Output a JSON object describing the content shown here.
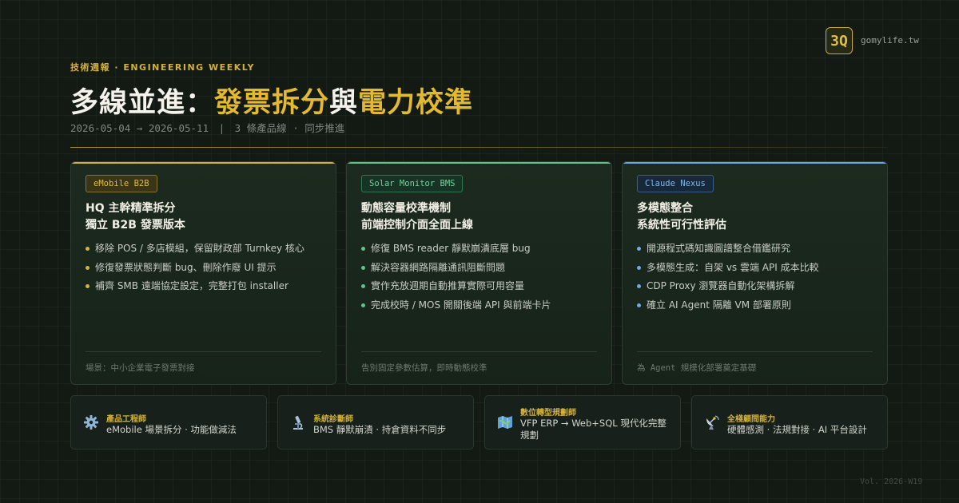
{
  "brand": {
    "logo_text": "3Q",
    "domain": "gomylife.tw"
  },
  "header": {
    "kicker": "技術週報 · ENGINEERING WEEKLY",
    "title_part1": "多線並進：",
    "title_part2": "發票拆分",
    "title_part3": "與",
    "title_part4": "電力校準",
    "meta": "2026-05-04 → 2026-05-11　|　3 條產品線 · 同步推進"
  },
  "colors": {
    "gold": "#d6b23a",
    "green": "#5ec48a",
    "blue": "#6ea8e6"
  },
  "cards": [
    {
      "tag": "eMobile B2B",
      "title_lines": [
        "HQ 主幹精準拆分",
        "獨立 B2B 發票版本"
      ],
      "bullets": [
        "移除 POS / 多店模組，保留財政部 Turnkey 核心",
        "修復發票狀態判斷 bug、刪除作廢 UI 提示",
        "補齊 SMB 遠端協定設定，完整打包 installer"
      ],
      "footer": "場景：中小企業電子發票對接"
    },
    {
      "tag": "Solar Monitor BMS",
      "title_lines": [
        "動態容量校準機制",
        "前端控制介面全面上線"
      ],
      "bullets": [
        "修復 BMS reader 靜默崩潰底層 bug",
        "解決容器網路隔離通訊阻斷問題",
        "實作充放週期自動推算實際可用容量",
        "完成校時 / MOS 開關後端 API 與前端卡片"
      ],
      "footer": "告別固定參數估算，即時動態校準"
    },
    {
      "tag": "Claude Nexus",
      "title_lines": [
        "多模態整合",
        "系統性可行性評估"
      ],
      "bullets": [
        "開源程式碼知識圖譜整合借鑑研究",
        "多模態生成：自架 vs 雲端 API 成本比較",
        "CDP Proxy 瀏覽器自動化架構拆解",
        "確立 AI Agent 隔離 VM 部署原則"
      ],
      "footer": "為 Agent 規模化部署奠定基礎"
    }
  ],
  "roles": [
    {
      "icon": "gear-icon",
      "title": "產品工程師",
      "desc": "eMobile 場景拆分 · 功能做減法"
    },
    {
      "icon": "microscope-icon",
      "title": "系統診斷師",
      "desc": "BMS 靜默崩潰 · 持倉資料不同步"
    },
    {
      "icon": "map-icon",
      "title": "數位轉型規劃師",
      "desc": "VFP ERP → Web+SQL 現代化完整規劃"
    },
    {
      "icon": "satellite-dish-icon",
      "title": "全棧顧問能力",
      "desc": "硬體感測 · 法規對接 · AI 平台設計"
    }
  ],
  "footer": {
    "volume": "Vol. 2026-W19"
  }
}
